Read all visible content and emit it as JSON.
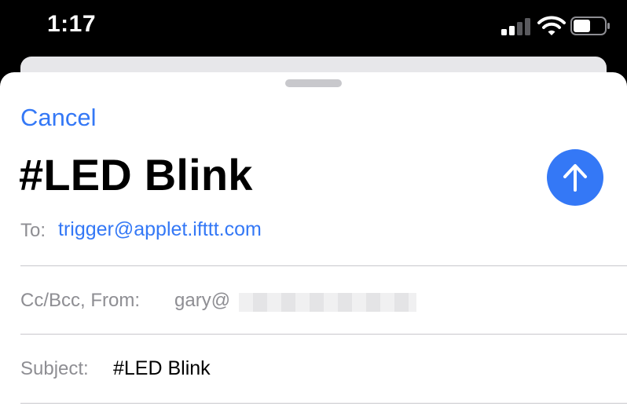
{
  "status_bar": {
    "time": "1:17",
    "signal_icon": "cellular-signal-icon",
    "wifi_icon": "wifi-icon",
    "battery_icon": "battery-icon"
  },
  "compose": {
    "cancel_label": "Cancel",
    "title": "#LED Blink",
    "send_icon": "arrow-up-icon",
    "accent_color": "#3478f6",
    "to": {
      "label": "To:",
      "value": "trigger@applet.ifttt.com"
    },
    "cc_from": {
      "label": "Cc/Bcc, From:",
      "value": "gary@"
    },
    "subject": {
      "label": "Subject:",
      "value": "#LED Blink"
    }
  }
}
